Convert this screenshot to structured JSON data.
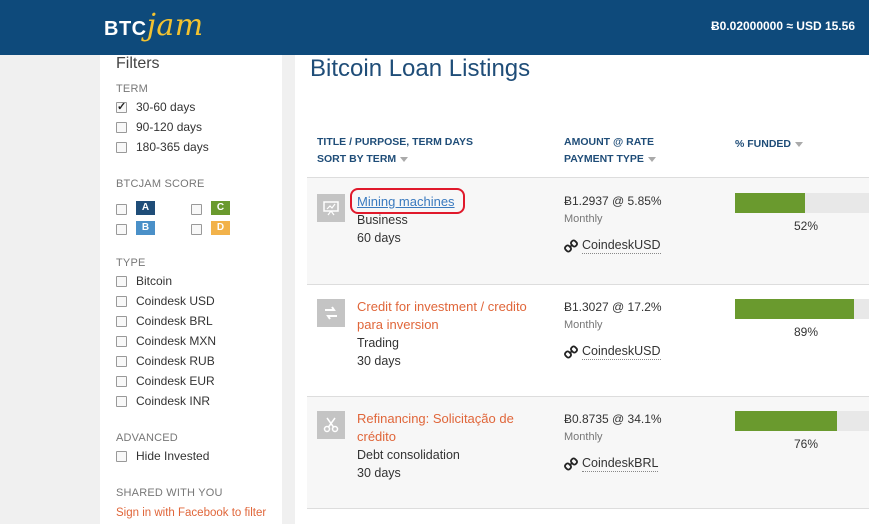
{
  "header": {
    "logo_btc": "BTC",
    "logo_jam": "jam",
    "balance": "Ƀ0.02000000 ≈ USD 15.56"
  },
  "sidebar": {
    "title": "Filters",
    "term": {
      "heading": "TERM",
      "options": [
        {
          "label": "30-60 days",
          "checked": true
        },
        {
          "label": "90-120 days",
          "checked": false
        },
        {
          "label": "180-365 days",
          "checked": false
        }
      ]
    },
    "score": {
      "heading": "BTCJAM SCORE",
      "grades": [
        {
          "label": "A",
          "color": "#1f4d78"
        },
        {
          "label": "C",
          "color": "#6a9a2e"
        },
        {
          "label": "B",
          "color": "#4a90c8"
        },
        {
          "label": "D",
          "color": "#f2b24a"
        }
      ]
    },
    "type": {
      "heading": "TYPE",
      "options": [
        "Bitcoin",
        "Coindesk USD",
        "Coindesk BRL",
        "Coindesk MXN",
        "Coindesk RUB",
        "Coindesk EUR",
        "Coindesk INR"
      ]
    },
    "advanced": {
      "heading": "ADVANCED",
      "options": [
        "Hide Invested"
      ]
    },
    "shared": {
      "heading": "SHARED WITH YOU",
      "link": "Sign in with Facebook to filter"
    }
  },
  "main": {
    "title": "Bitcoin Loan Listings",
    "columns": {
      "title_line1": "TITLE / PURPOSE, TERM DAYS",
      "title_line2": "SORT BY TERM",
      "amount_line1": "AMOUNT @ RATE",
      "amount_line2": "PAYMENT TYPE",
      "funded": "% FUNDED"
    },
    "listings": [
      {
        "icon": "chart-presentation-icon",
        "title_line1": "Mining machines",
        "title_line2": "",
        "purpose": "Business",
        "term": "60 days",
        "amount": "Ƀ1.2937 @ 5.85%",
        "frequency": "Monthly",
        "payment_type": "CoindeskUSD",
        "funded_pct": "52%",
        "funded": 0.52
      },
      {
        "icon": "exchange-arrows-icon",
        "title_line1": "Credit for investment / credito",
        "title_line2": "para inversion",
        "purpose": "Trading",
        "term": "30 days",
        "amount": "Ƀ1.3027 @ 17.2%",
        "frequency": "Monthly",
        "payment_type": "CoindeskUSD",
        "funded_pct": "89%",
        "funded": 0.89
      },
      {
        "icon": "scissors-icon",
        "title_line1": "Refinancing: Solicitação de",
        "title_line2": "crédito",
        "purpose": "Debt consolidation",
        "term": "30 days",
        "amount": "Ƀ0.8735 @ 34.1%",
        "frequency": "Monthly",
        "payment_type": "CoindeskBRL",
        "funded_pct": "76%",
        "funded": 0.76
      }
    ]
  }
}
